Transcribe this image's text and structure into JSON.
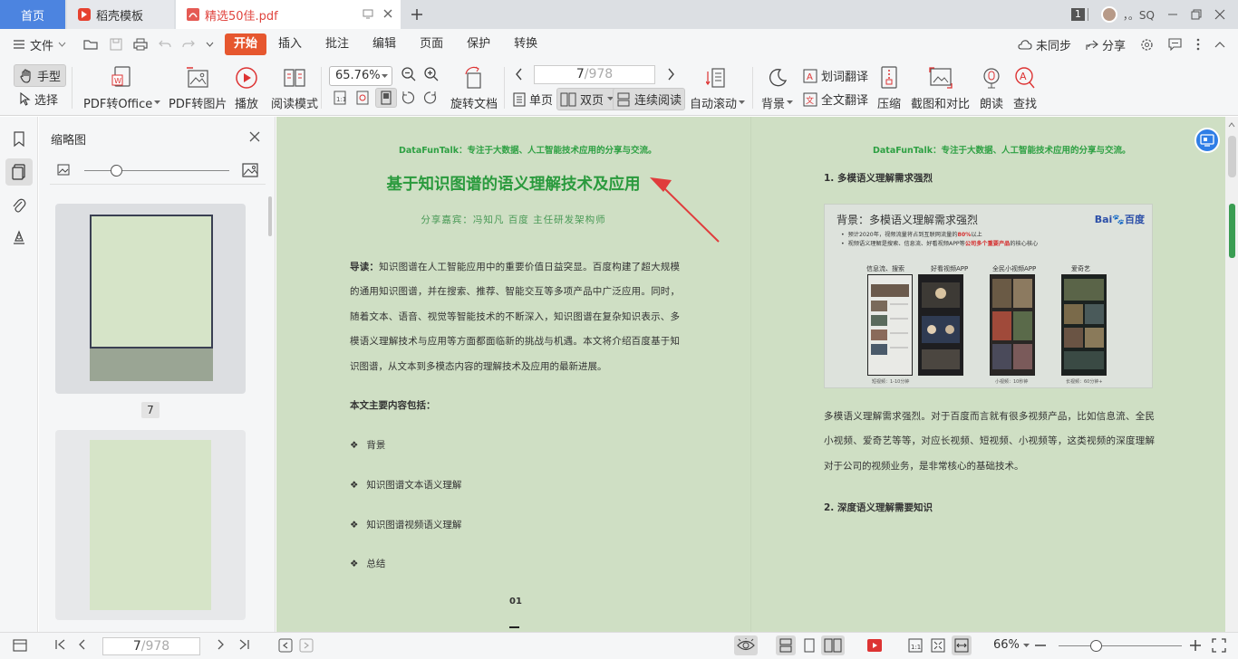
{
  "titlebar": {
    "tabs": [
      {
        "label": "首页"
      },
      {
        "label": "稻壳模板"
      },
      {
        "label": "精选50佳.pdf"
      }
    ],
    "badge": "1",
    "user_name": "，。SQ"
  },
  "menubar": {
    "file_label": "文件",
    "items": [
      "开始",
      "插入",
      "批注",
      "编辑",
      "页面",
      "保护",
      "转换"
    ],
    "sync_label": "未同步",
    "share_label": "分享"
  },
  "toolbar": {
    "hand_label": "手型",
    "select_label": "选择",
    "pdf_to_office": "PDF转Office",
    "pdf_to_image": "PDF转图片",
    "play": "播放",
    "read_mode": "阅读模式",
    "zoom_value": "65.76%",
    "rotate_doc": "旋转文档",
    "page_current": "7",
    "page_total": "/978",
    "single_page": "单页",
    "double_page": "双页",
    "continuous": "连续阅读",
    "auto_scroll": "自动滚动",
    "background": "背景",
    "word_translate": "划词翻译",
    "full_translate": "全文翻译",
    "compress": "压缩",
    "screenshot_compare": "截图和对比",
    "read_aloud": "朗读",
    "find": "查找"
  },
  "thumbnails": {
    "title": "缩略图",
    "page_label": "7"
  },
  "document": {
    "left": {
      "header": "DataFunTalk：专注于大数据、人工智能技术应用的分享与交流。",
      "title": "基于知识图谱的语义理解技术及应用",
      "subtitle": "分享嘉宾：冯知凡 百度 主任研发架构师",
      "intro_label": "导读：",
      "intro_text": "知识图谱在人工智能应用中的重要价值日益突显。百度构建了超大规模的通用知识图谱，并在搜索、推荐、智能交互等多项产品中广泛应用。同时，随着文本、语音、视觉等智能技术的不断深入，知识图谱在复杂知识表示、多模语义理解技术与应用等方面都面临新的挑战与机遇。本文将介绍百度基于知识图谱，从文本到多模态内容的理解技术及应用的最新进展。",
      "toc_heading": "本文主要内容包括：",
      "toc_bullet": "❖",
      "toc": [
        "背景",
        "知识图谱文本语义理解",
        "知识图谱视频语义理解",
        "总结"
      ],
      "page_number": "01"
    },
    "right": {
      "header": "DataFunTalk：专注于大数据、人工智能技术应用的分享与交流。",
      "heading1": "1. 多模语义理解需求强烈",
      "slide": {
        "title": "背景：多模语义理解需求强烈",
        "logo_a": "Bai",
        "logo_b": "百度",
        "bullet1_a": "预计2020年，视频流量将占到互联网流量的",
        "bullet1_b": "80%",
        "bullet1_c": "以上",
        "bullet2_a": "视频语义理解是搜索、信息流、好看视频APP等",
        "bullet2_b": "公司多个重要产品",
        "bullet2_c": "的核心核心",
        "phones": [
          {
            "label": "信息流、搜索",
            "caption": "短视频：1-10分钟"
          },
          {
            "label": "好看视频APP",
            "caption": ""
          },
          {
            "label": "全民小视频APP",
            "caption": "小视频：10秒钟"
          },
          {
            "label": "爱奇艺",
            "caption": "长视频：60分钟+"
          }
        ]
      },
      "body": "多模语义理解需求强烈。对于百度而言就有很多视频产品，比如信息流、全民小视频、爱奇艺等等，对应长视频、短视频、小视频等，这类视频的深度理解对于公司的视频业务，是非常核心的基础技术。",
      "heading2": "2. 深度语义理解需要知识"
    }
  },
  "statusbar": {
    "page_current": "7",
    "page_total": "/978",
    "zoom": "66%"
  },
  "colors": {
    "accent": "#4c84e0",
    "start_tab": "#e6572f",
    "doc_background": "#cfdfc4",
    "title_green": "#2a9a3d",
    "arrow_red": "#e03c3c"
  }
}
